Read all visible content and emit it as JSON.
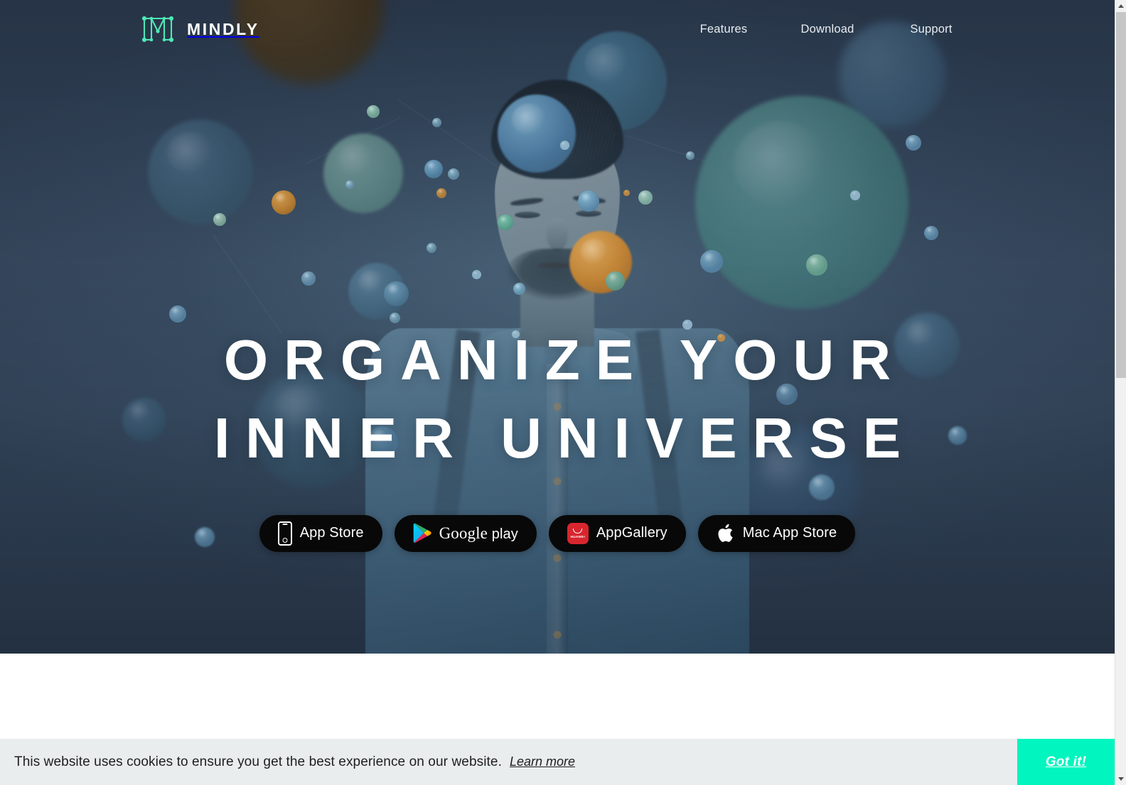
{
  "header": {
    "logo_text": "MINDLY",
    "logo_icon": "mindly-node-m-logo",
    "nav": [
      {
        "label": "Features",
        "name": "nav-features"
      },
      {
        "label": "Download",
        "name": "nav-download"
      },
      {
        "label": "Support",
        "name": "nav-support"
      }
    ]
  },
  "hero": {
    "headline_line1": "ORGANIZE YOUR",
    "headline_line2": "INNER UNIVERSE",
    "stores": [
      {
        "label": "App Store",
        "icon": "iphone-icon",
        "name": "app-store-button"
      },
      {
        "label": "Google",
        "label_suffix": "play",
        "icon": "google-play-icon",
        "name": "google-play-button"
      },
      {
        "label": "AppGallery",
        "icon": "huawei-appgallery-icon",
        "name": "appgallery-button"
      },
      {
        "label": "Mac App Store",
        "icon": "apple-icon",
        "name": "mac-app-store-button"
      }
    ]
  },
  "cookie": {
    "message": "This website uses cookies to ensure you get the best experience on our website.",
    "learn_more": "Learn more",
    "accept": "Got it!"
  },
  "colors": {
    "hero_background": "#3d4f66",
    "brand_accent": "#4ee7b4",
    "cookie_accept": "#00f5bf",
    "cookie_bar": "#e9eded",
    "headline": "#ffffff"
  }
}
